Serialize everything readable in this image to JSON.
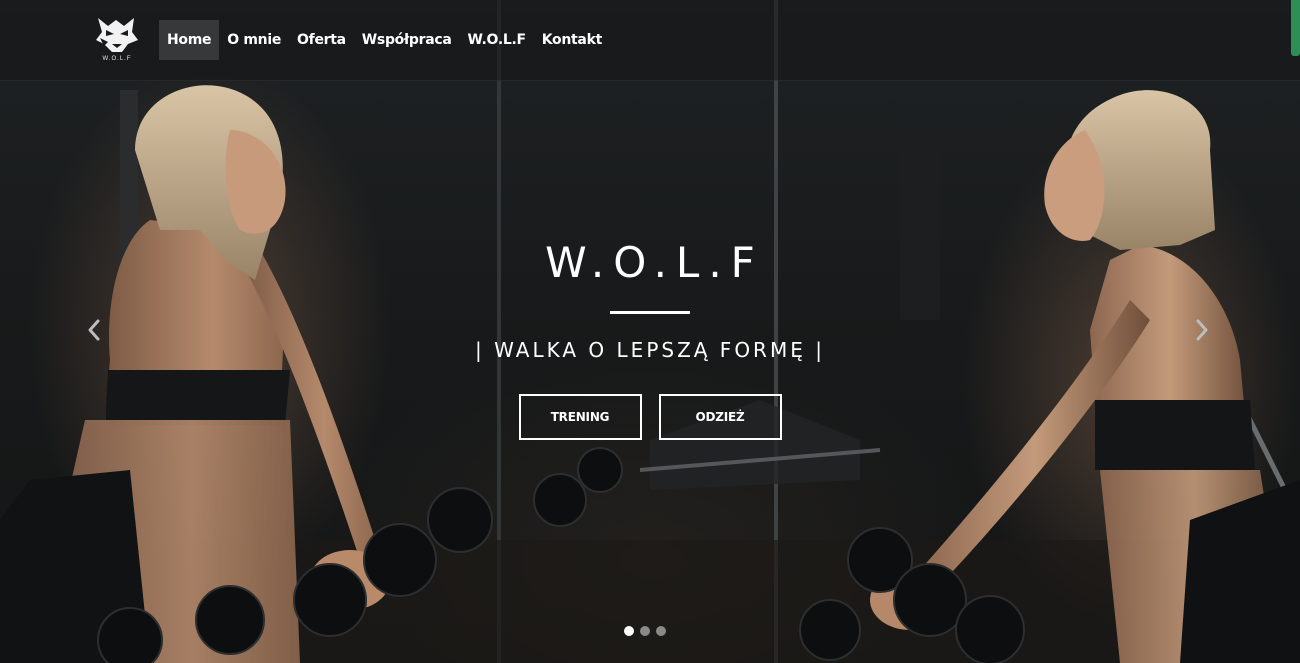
{
  "brand": {
    "logo_icon": "wolf-head-icon",
    "logo_text": "W.O.L.F"
  },
  "nav": {
    "items": [
      {
        "label": "Home",
        "active": true
      },
      {
        "label": "O mnie"
      },
      {
        "label": "Oferta"
      },
      {
        "label": "Współpraca"
      },
      {
        "label": "W.O.L.F"
      },
      {
        "label": "Kontakt"
      }
    ]
  },
  "hero": {
    "title": "W.O.L.F",
    "subtitle": "| WALKA O LEPSZĄ FORMĘ |",
    "buttons": [
      {
        "label": "TRENING"
      },
      {
        "label": "ODZIEŻ"
      }
    ]
  },
  "carousel": {
    "prev_icon": "chevron-left-icon",
    "next_icon": "chevron-right-icon",
    "slide_count": 3,
    "active_slide": 1
  },
  "colors": {
    "accent": "#2d8f55",
    "text": "#ffffff",
    "background": "#141617"
  }
}
